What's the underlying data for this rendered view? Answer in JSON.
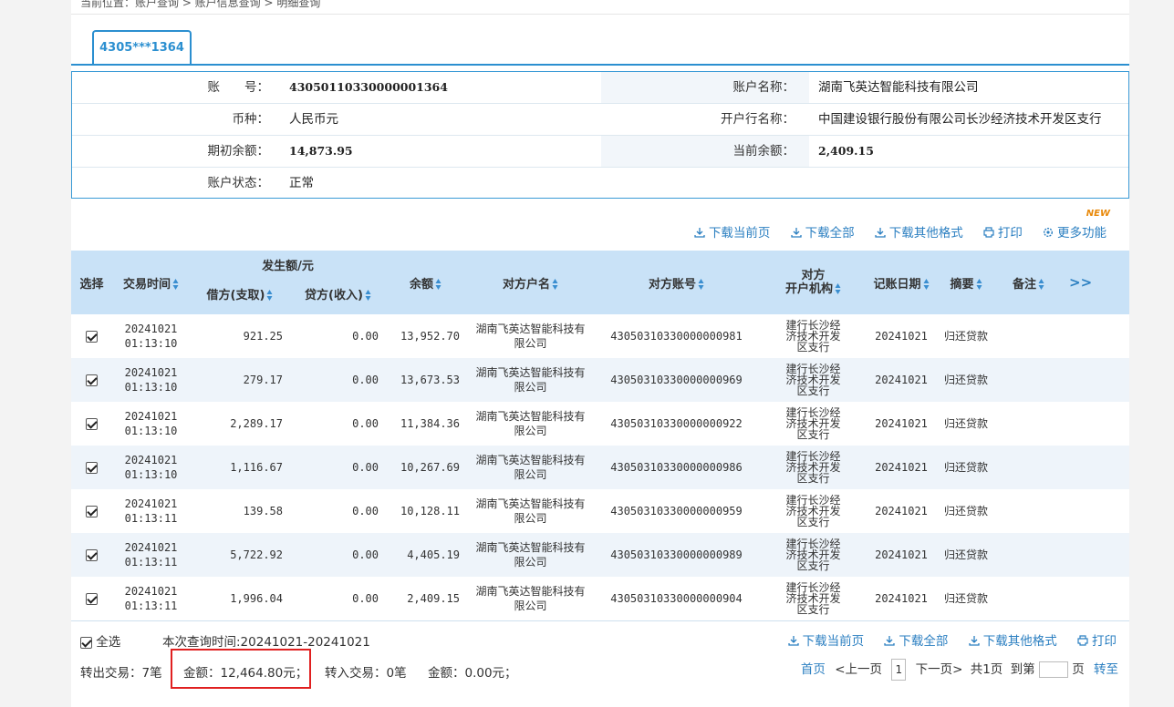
{
  "breadcrumb": "当前位置：账户查询 > 账户信息查询 > 明细查询",
  "tab_label": "4305***1364",
  "account": {
    "account_no_label": "账　　号：",
    "account_no": "43050110330000001364",
    "account_name_label": "账户名称：",
    "account_name": "湖南飞英达智能科技有限公司",
    "currency_label": "币种：",
    "currency": "人民币元",
    "bank_label": "开户行名称：",
    "bank": "中国建设银行股份有限公司长沙经济技术开发区支行",
    "opening_balance_label": "期初余额：",
    "opening_balance": "14,873.95",
    "current_balance_label": "当前余额：",
    "current_balance": "2,409.15",
    "status_label": "账户状态：",
    "status": "正常"
  },
  "toolbar": {
    "new_badge": "NEW",
    "download_page": "下载当前页",
    "download_all": "下载全部",
    "download_other": "下载其他格式",
    "print": "打印",
    "more": "更多功能"
  },
  "table": {
    "headers": {
      "select": "选择",
      "time": "交易时间",
      "amount_group": "发生额/元",
      "debit": "借方(支取)",
      "credit": "贷方(收入)",
      "balance": "余额",
      "counter_name": "对方户名",
      "counter_account": "对方账号",
      "counter_bank_1": "对方",
      "counter_bank_2": "开户机构",
      "book_date": "记账日期",
      "summary": "摘要",
      "remark": "备注",
      "more": ">>"
    },
    "rows": [
      {
        "date": "20241021",
        "time": "01:13:10",
        "debit": "921.25",
        "credit": "0.00",
        "balance": "13,952.70",
        "name": "湖南飞英达智能科技有限公司",
        "account": "43050310330000000981",
        "bank": "建行长沙经济技术开发区支行",
        "book_date": "20241021",
        "summary": "归还贷款"
      },
      {
        "date": "20241021",
        "time": "01:13:10",
        "debit": "279.17",
        "credit": "0.00",
        "balance": "13,673.53",
        "name": "湖南飞英达智能科技有限公司",
        "account": "43050310330000000969",
        "bank": "建行长沙经济技术开发区支行",
        "book_date": "20241021",
        "summary": "归还贷款"
      },
      {
        "date": "20241021",
        "time": "01:13:10",
        "debit": "2,289.17",
        "credit": "0.00",
        "balance": "11,384.36",
        "name": "湖南飞英达智能科技有限公司",
        "account": "43050310330000000922",
        "bank": "建行长沙经济技术开发区支行",
        "book_date": "20241021",
        "summary": "归还贷款"
      },
      {
        "date": "20241021",
        "time": "01:13:10",
        "debit": "1,116.67",
        "credit": "0.00",
        "balance": "10,267.69",
        "name": "湖南飞英达智能科技有限公司",
        "account": "43050310330000000986",
        "bank": "建行长沙经济技术开发区支行",
        "book_date": "20241021",
        "summary": "归还贷款"
      },
      {
        "date": "20241021",
        "time": "01:13:11",
        "debit": "139.58",
        "credit": "0.00",
        "balance": "10,128.11",
        "name": "湖南飞英达智能科技有限公司",
        "account": "43050310330000000959",
        "bank": "建行长沙经济技术开发区支行",
        "book_date": "20241021",
        "summary": "归还贷款"
      },
      {
        "date": "20241021",
        "time": "01:13:11",
        "debit": "5,722.92",
        "credit": "0.00",
        "balance": "4,405.19",
        "name": "湖南飞英达智能科技有限公司",
        "account": "43050310330000000989",
        "bank": "建行长沙经济技术开发区支行",
        "book_date": "20241021",
        "summary": "归还贷款"
      },
      {
        "date": "20241021",
        "time": "01:13:11",
        "debit": "1,996.04",
        "credit": "0.00",
        "balance": "2,409.15",
        "name": "湖南飞英达智能科技有限公司",
        "account": "43050310330000000904",
        "bank": "建行长沙经济技术开发区支行",
        "book_date": "20241021",
        "summary": "归还贷款"
      }
    ]
  },
  "footer": {
    "select_all": "全选",
    "query_time": "本次查询时间:20241021-20241021",
    "download_page": "下载当前页",
    "download_all": "下载全部",
    "download_other": "下载其他格式",
    "print": "打印",
    "out_count": "转出交易：7笔",
    "out_amount": "金额：12,464.80元；",
    "in_count": "转入交易：0笔",
    "in_amount": "金额：0.00元；",
    "first": "首页",
    "prev": "<上一页",
    "page": "1",
    "next": "下一页>",
    "total": "共1页",
    "goto": "到第",
    "page_unit": "页",
    "go": "转至"
  },
  "colors": {
    "accent": "#2b8fd0",
    "header_bg": "#c9e2f7",
    "row_alt": "#eef4fa",
    "highlight": "#e02020"
  }
}
